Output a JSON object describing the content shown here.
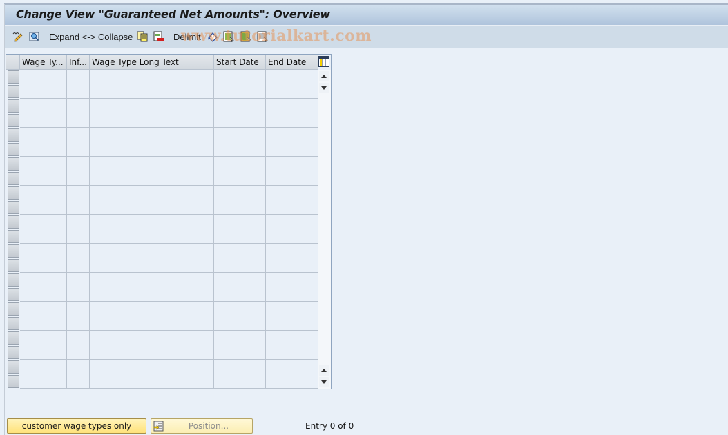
{
  "title": "Change View \"Guaranteed Net Amounts\": Overview",
  "toolbar": {
    "items": [
      {
        "type": "icon",
        "name": "change-display-icon"
      },
      {
        "type": "icon",
        "name": "select-details-icon"
      },
      {
        "type": "text",
        "label": "Expand <-> Collapse"
      },
      {
        "type": "icon",
        "name": "copy-as-icon"
      },
      {
        "type": "icon",
        "name": "delete-icon"
      },
      {
        "type": "text",
        "label": "Delimit"
      },
      {
        "type": "icon",
        "name": "undo-change-icon"
      },
      {
        "type": "icon",
        "name": "select-all-icon"
      },
      {
        "type": "icon",
        "name": "select-block-icon"
      },
      {
        "type": "icon",
        "name": "deselect-all-icon"
      }
    ],
    "expand_collapse_label": "Expand <-> Collapse",
    "delimit_label": "Delimit"
  },
  "watermark": "www.tutorialkart.com",
  "table": {
    "columns": [
      "Wage Ty...",
      "Inf...",
      "Wage Type Long Text",
      "Start Date",
      "End Date"
    ],
    "row_count": 22,
    "rows": []
  },
  "footer": {
    "customer_button": "customer wage types only",
    "position_button": "Position...",
    "entry_status": "Entry 0 of 0"
  }
}
